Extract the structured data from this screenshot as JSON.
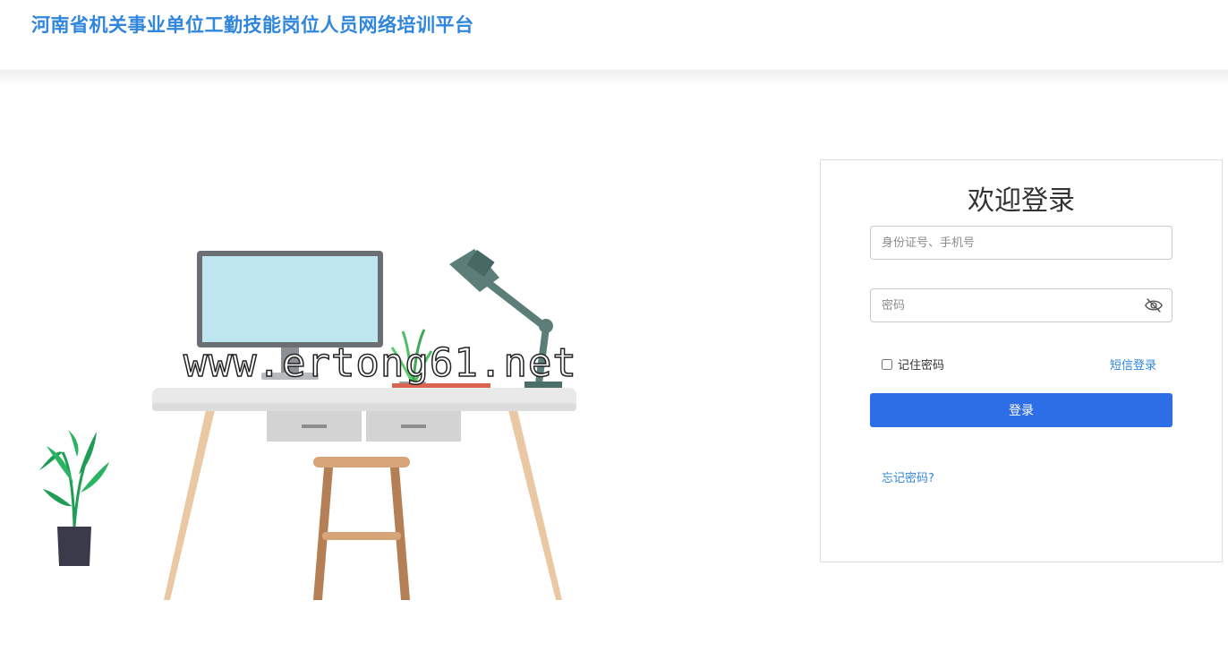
{
  "header": {
    "title": "河南省机关事业单位工勤技能岗位人员网络培训平台"
  },
  "watermark": "www.ertong61.net",
  "login": {
    "title": "欢迎登录",
    "username_placeholder": "身份证号、手机号",
    "password_placeholder": "密码",
    "remember_label": "记住密码",
    "sms_login_label": "短信登录",
    "submit_label": "登录",
    "forgot_label": "忘记密码?"
  },
  "colors": {
    "brand": "#2f86dc",
    "button": "#2d6de6"
  }
}
